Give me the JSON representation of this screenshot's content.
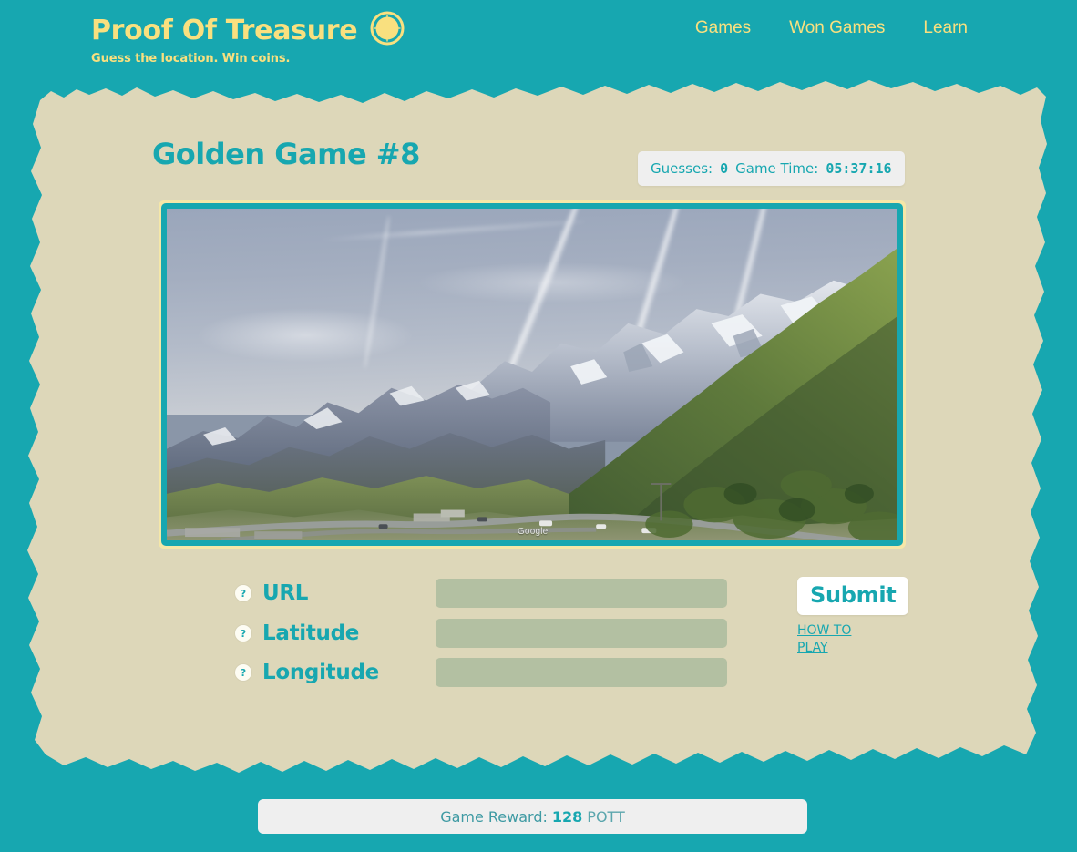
{
  "colors": {
    "brand_teal": "#17a7b0",
    "brand_yellow": "#f9e07f",
    "paper": "#ddd7b9",
    "input_green": "#b3c0a2",
    "bar_gray": "#efefef"
  },
  "header": {
    "brand_title": "Proof Of Treasure",
    "tagline": "Guess the location. Win coins.",
    "logo_icon": "compass-icon",
    "nav": [
      {
        "label": "Games"
      },
      {
        "label": "Won Games"
      },
      {
        "label": "Learn"
      }
    ]
  },
  "main": {
    "page_title": "Golden Game #8",
    "stats": {
      "guesses_label": "Guesses:",
      "guesses_value": "0",
      "time_label": "Game Time:",
      "time_value": "05:37:16"
    },
    "photo": {
      "watermark": "Google",
      "alt": "Alpine mountain pass with snow-capped peaks, green slopes and a winding road"
    },
    "form": {
      "fields": [
        {
          "help_icon": "?",
          "label": "URL",
          "value": "",
          "placeholder": ""
        },
        {
          "help_icon": "?",
          "label": "Latitude",
          "value": "",
          "placeholder": ""
        },
        {
          "help_icon": "?",
          "label": "Longitude",
          "value": "",
          "placeholder": ""
        }
      ],
      "submit_label": "Submit",
      "howto_label": "HOW TO PLAY"
    }
  },
  "footer": {
    "reward_label": "Game Reward:",
    "reward_value": "128",
    "reward_unit": "POTT"
  }
}
